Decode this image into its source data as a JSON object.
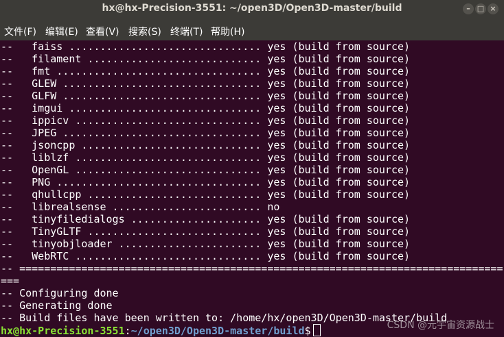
{
  "window": {
    "title": "hx@hx-Precision-3551: ~/open3D/Open3D-master/build",
    "minimize_glyph": "–",
    "maximize_glyph": "□",
    "close_glyph": "×"
  },
  "menu": {
    "file": "文件(F)",
    "edit": "编辑(E)",
    "view": "查看(V)",
    "search": "搜索(S)",
    "terminal": "终端(T)",
    "help": "帮助(H)"
  },
  "terminal": {
    "lines": [
      "--   faiss ............................... yes (build from source)",
      "--   filament ............................ yes (build from source)",
      "--   fmt ................................. yes (build from source)",
      "--   GLEW ................................ yes (build from source)",
      "--   GLFW ................................ yes (build from source)",
      "--   imgui ............................... yes (build from source)",
      "--   ippicv .............................. yes (build from source)",
      "--   JPEG ................................ yes (build from source)",
      "--   jsoncpp ............................. yes (build from source)",
      "--   liblzf .............................. yes (build from source)",
      "--   OpenGL .............................. yes (build from source)",
      "--   PNG ................................. yes (build from source)",
      "--   qhullcpp ............................ yes (build from source)",
      "--   librealsense ........................ no",
      "--   tinyfiledialogs ..................... yes (build from source)",
      "--   TinyGLTF ............................ yes (build from source)",
      "--   tinyobjloader ....................... yes (build from source)",
      "--   WebRTC .............................. yes (build from source)",
      "-- ==============================================================================",
      "===",
      "-- Configuring done",
      "-- Generating done",
      "-- Build files have been written to: /home/hx/open3D/Open3D-master/build"
    ],
    "prompt_user": "hx@hx-Precision-3551",
    "prompt_sep": ":",
    "prompt_path": "~/open3D/Open3D-master/build",
    "prompt_symbol": "$"
  },
  "watermark": "CSDN @元宇宙资源战士"
}
